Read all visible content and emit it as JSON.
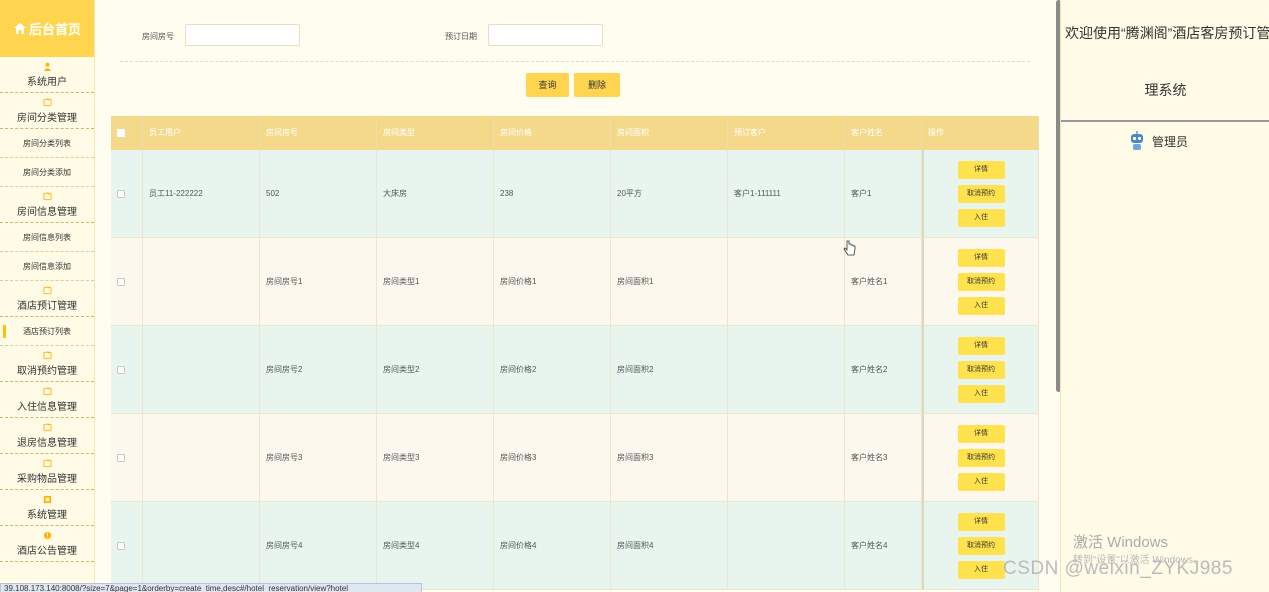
{
  "sidebar": {
    "brand": "后台首页",
    "groups": [
      {
        "label": "系统用户",
        "icon": "user-icon"
      },
      {
        "label": "房间分类管理",
        "icon": "folder-icon",
        "subs": [
          "房间分类列表",
          "房间分类添加"
        ]
      },
      {
        "label": "房间信息管理",
        "icon": "folder-icon",
        "subs": [
          "房间信息列表",
          "房间信息添加"
        ]
      },
      {
        "label": "酒店预订管理",
        "icon": "folder-icon",
        "subs": [
          "酒店预订列表"
        ]
      },
      {
        "label": "取消预约管理",
        "icon": "folder-icon"
      },
      {
        "label": "入住信息管理",
        "icon": "folder-icon"
      },
      {
        "label": "退房信息管理",
        "icon": "folder-icon"
      },
      {
        "label": "采购物品管理",
        "icon": "folder-icon"
      },
      {
        "label": "系统管理",
        "icon": "settings-icon"
      },
      {
        "label": "酒店公告管理",
        "icon": "info-icon"
      }
    ]
  },
  "search": {
    "room_no_label": "房间房号",
    "room_no_value": "",
    "date_label": "预订日期",
    "date_value": "",
    "query_button": "查询",
    "delete_button": "删除"
  },
  "table": {
    "headers": [
      "员工用户",
      "房间房号",
      "房间类型",
      "房间价格",
      "房间面积",
      "预订客户",
      "客户姓名",
      "操作"
    ],
    "rows": [
      {
        "staff": "员工11-222222",
        "room_no": "502",
        "room_type": "大床房",
        "price": "238",
        "area": "20平方",
        "customer": "客户1-111111",
        "name": "客户1"
      },
      {
        "staff": "",
        "room_no": "房间房号1",
        "room_type": "房间类型1",
        "price": "房间价格1",
        "area": "房间面积1",
        "customer": "",
        "name": "客户姓名1"
      },
      {
        "staff": "",
        "room_no": "房间房号2",
        "room_type": "房间类型2",
        "price": "房间价格2",
        "area": "房间面积2",
        "customer": "",
        "name": "客户姓名2"
      },
      {
        "staff": "",
        "room_no": "房间房号3",
        "room_type": "房间类型3",
        "price": "房间价格3",
        "area": "房间面积3",
        "customer": "",
        "name": "客户姓名3"
      },
      {
        "staff": "",
        "room_no": "房间房号4",
        "room_type": "房间类型4",
        "price": "房间价格4",
        "area": "房间面积4",
        "customer": "",
        "name": "客户姓名4"
      }
    ],
    "actions": [
      "详情",
      "取消预约",
      "入住"
    ]
  },
  "right": {
    "welcome_line1": "欢迎使用“腾渊阁”酒店客房预订管",
    "welcome_line2": "理系统",
    "admin_label": "管理员",
    "watermark1": "激活 Windows",
    "watermark2": "转到“设置”以激活 Windows。"
  },
  "csdn": "CSDN @weixin_ZYKJ985",
  "status_url": "39.108.173.140:8008/?size=7&page=1&orderby=create_time,desc#/hotel_reservation/view?hotel",
  "colors": {
    "accent": "#ffd54f",
    "header": "#f5d98b",
    "row_mint": "#e8f5ee",
    "row_cream": "#fdf8ee"
  }
}
